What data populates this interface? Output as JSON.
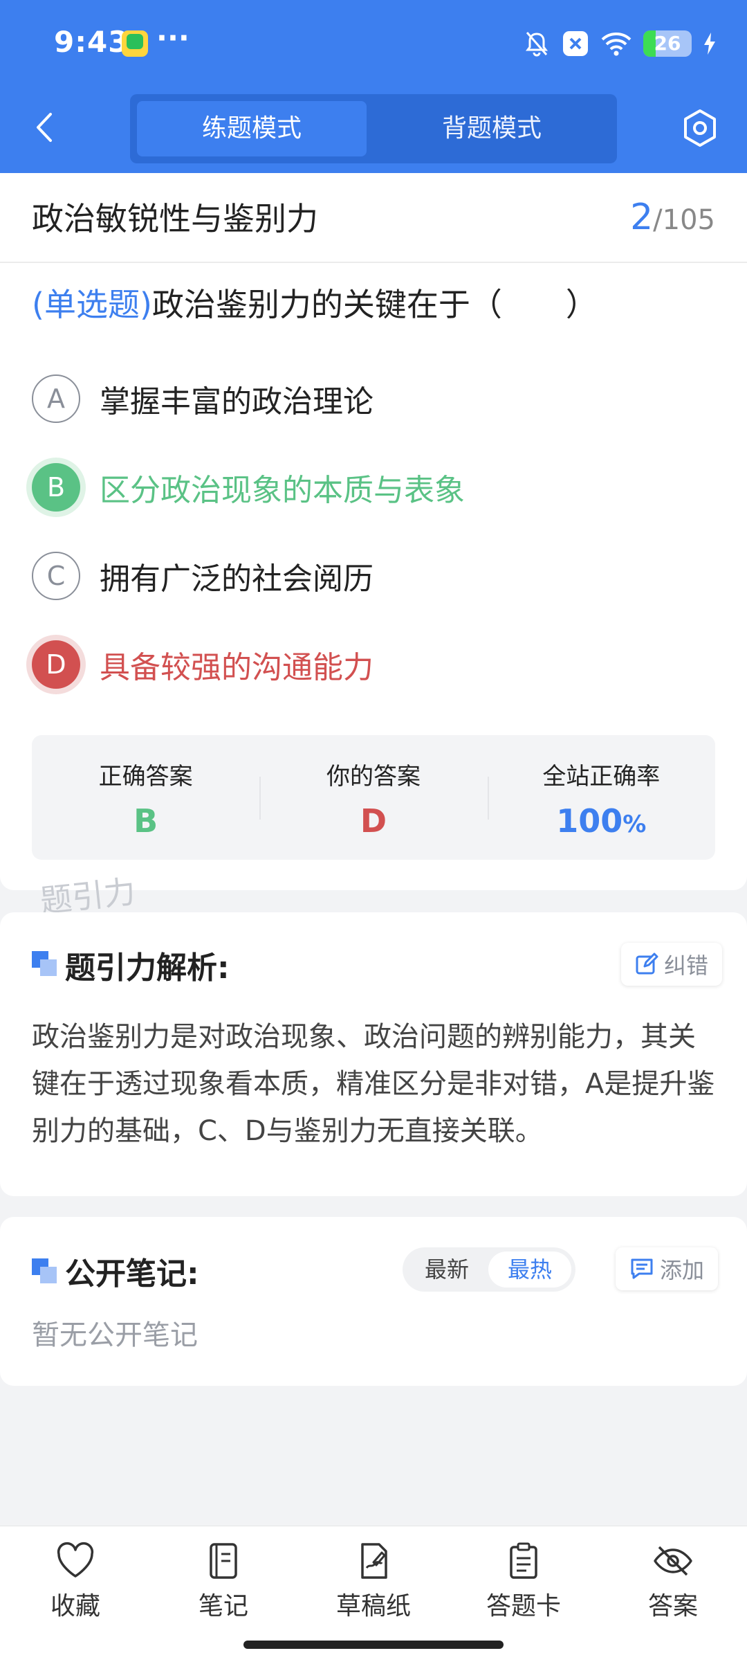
{
  "status_bar": {
    "time": "9:43",
    "more": "···",
    "battery_level": 26,
    "battery_label": "26",
    "icons": [
      "app-icon",
      "mute-icon",
      "x-icon",
      "wifi-icon",
      "battery-icon",
      "charging-icon"
    ]
  },
  "header": {
    "mode_practice": "练题模式",
    "mode_memorize": "背题模式",
    "active_mode": "practice"
  },
  "quiz": {
    "section_title": "政治敏锐性与鉴别力",
    "current": "2",
    "total": "/105",
    "question_type": "(单选题)",
    "question_text": "政治鉴别力的关键在于（　　）",
    "options": [
      {
        "letter": "A",
        "text": "掌握丰富的政治理论",
        "state": "normal"
      },
      {
        "letter": "B",
        "text": "区分政治现象的本质与表象",
        "state": "correct"
      },
      {
        "letter": "C",
        "text": "拥有广泛的社会阅历",
        "state": "normal"
      },
      {
        "letter": "D",
        "text": "具备较强的沟通能力",
        "state": "wrong"
      }
    ],
    "summary": {
      "correct_label": "正确答案",
      "correct_value": "B",
      "yours_label": "你的答案",
      "yours_value": "D",
      "rate_label": "全站正确率",
      "rate_value": "100",
      "rate_unit": "%"
    },
    "watermark": "题引力"
  },
  "explanation": {
    "title": "题引力解析:",
    "report_label": "纠错",
    "text": "政治鉴别力是对政治现象、政治问题的辨别能力，其关键在于透过现象看本质，精准区分是非对错，A是提升鉴别力的基础，C、D与鉴别力无直接关联。"
  },
  "notes": {
    "title": "公开笔记:",
    "sort_newest": "最新",
    "sort_hottest": "最热",
    "add_label": "添加",
    "empty_text": "暂无公开笔记"
  },
  "bottom_nav": [
    {
      "label": "收藏",
      "icon": "heart-icon"
    },
    {
      "label": "笔记",
      "icon": "notebook-icon"
    },
    {
      "label": "草稿纸",
      "icon": "draft-icon"
    },
    {
      "label": "答题卡",
      "icon": "clipboard-icon"
    },
    {
      "label": "答案",
      "icon": "eye-off-icon"
    }
  ],
  "colors": {
    "primary": "#3d7fef",
    "correct": "#5ac285",
    "wrong": "#d25050",
    "rate": "#3d7fef"
  }
}
